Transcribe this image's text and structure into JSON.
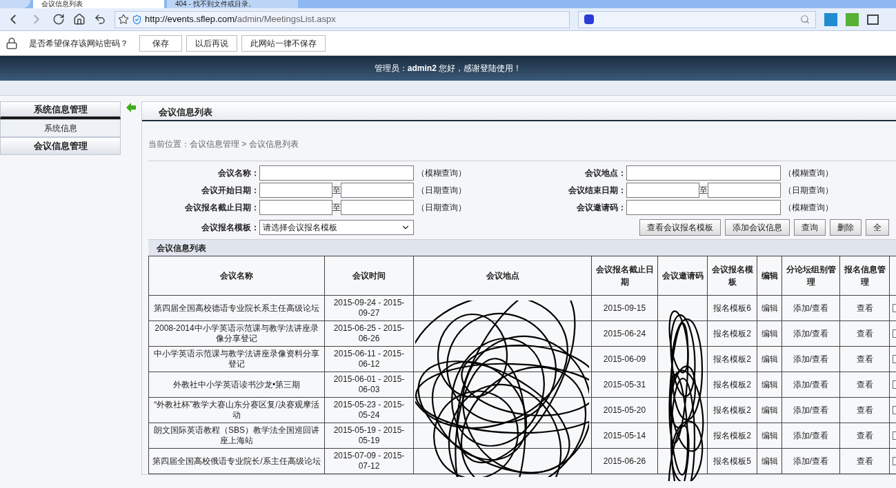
{
  "browser": {
    "tabs": [
      {
        "label": "会议信息列表",
        "selected": true
      },
      {
        "label": "404 - 找不到文件或目录。",
        "selected": false
      }
    ],
    "url_host": "http://events.sflep.com/",
    "url_path": "admin/MeetingsList.aspx"
  },
  "password_bar": {
    "prompt": "是否希望保存该网站密码？",
    "buttons": [
      "保存",
      "以后再说",
      "此网站一律不保存"
    ]
  },
  "header": {
    "greeting": "管理员：**admin2** 您好，感谢登陆使用！"
  },
  "sidebar": [
    {
      "title": "系统信息管理",
      "expanded": true,
      "items": [
        "系统信息"
      ]
    },
    {
      "title": "会议信息管理",
      "expanded": false
    }
  ],
  "panel": {
    "title": "会议信息列表",
    "breadcrumb": "当前位置：会议信息管理 > 会议信息列表"
  },
  "filters_left": [
    {
      "kind": "text",
      "label": "会议名称：",
      "hint": "（模糊查询）"
    },
    {
      "kind": "range",
      "label": "会议开始日期：",
      "separator": "至",
      "hint": "（日期查询）"
    },
    {
      "kind": "range",
      "label": "会议报名截止日期：",
      "separator": "至",
      "hint": "（日期查询）"
    },
    {
      "kind": "select",
      "label": "会议报名模板：",
      "value": "请选择会议报名模板"
    }
  ],
  "filters_right": [
    {
      "kind": "text",
      "label": "会议地点：",
      "hint": "（模糊查询）"
    },
    {
      "kind": "range",
      "label": "会议结束日期：",
      "separator": "至",
      "hint": "（日期查询）"
    },
    {
      "kind": "text",
      "label": "会议邀请码：",
      "hint": "（模糊查询）"
    }
  ],
  "actions": [
    "查看会议报名模板",
    "添加会议信息",
    "查询",
    "删除",
    "全"
  ],
  "table": {
    "title": "会议信息列表",
    "columns": [
      "会议名称",
      "会议时间",
      "会议地点",
      "会议报名截止日期",
      "会议邀请码",
      "会议报名模板",
      "编辑",
      "分论坛组别管理",
      "报名信息管理"
    ],
    "rows": [
      {
        "name": "第四届全国高校德语专业院长系主任高级论坛",
        "time": "2015-09-24 - 2015-09-27",
        "deadline": "2015-09-15",
        "template": "报名模板6",
        "edit": "编辑",
        "forum": "添加/查看",
        "reg": "查看",
        "checked": false
      },
      {
        "name": "2008-2014中小学英语示范课与教学法讲座录像分享登记",
        "time": "2015-06-25 - 2015-06-26",
        "deadline": "2015-06-24",
        "template": "报名模板2",
        "edit": "编辑",
        "forum": "添加/查看",
        "reg": "查看",
        "checked": false
      },
      {
        "name": "中小学英语示范课与教学法讲座录像资料分享登记",
        "time": "2015-06-11 - 2015-06-12",
        "deadline": "2015-06-09",
        "template": "报名模板2",
        "edit": "编辑",
        "forum": "添加/查看",
        "reg": "查看",
        "checked": false
      },
      {
        "name": "外教社中小学英语读书沙龙•第三期",
        "time": "2015-06-01 - 2015-06-03",
        "deadline": "2015-05-31",
        "template": "报名模板2",
        "edit": "编辑",
        "forum": "添加/查看",
        "reg": "查看",
        "checked": false
      },
      {
        "name": "“外教社杯”教学大赛山东分赛区复/决赛观摩活动",
        "time": "2015-05-23 - 2015-05-24",
        "deadline": "2015-05-20",
        "template": "报名模板2",
        "edit": "编辑",
        "forum": "添加/查看",
        "reg": "查看",
        "checked": false
      },
      {
        "name": "朗文国际英语教程（SBS）教学法全国巡回讲座上海站",
        "time": "2015-05-19 - 2015-05-19",
        "deadline": "2015-05-14",
        "template": "报名模板2",
        "edit": "编辑",
        "forum": "添加/查看",
        "reg": "查看",
        "checked": false
      },
      {
        "name": "第四届全国高校俄语专业院长/系主任高级论坛",
        "time": "2015-07-09 - 2015-07-12",
        "deadline": "2015-06-26",
        "template": "报名模板5",
        "edit": "编辑",
        "forum": "添加/查看",
        "reg": "查看",
        "checked": false
      }
    ]
  }
}
